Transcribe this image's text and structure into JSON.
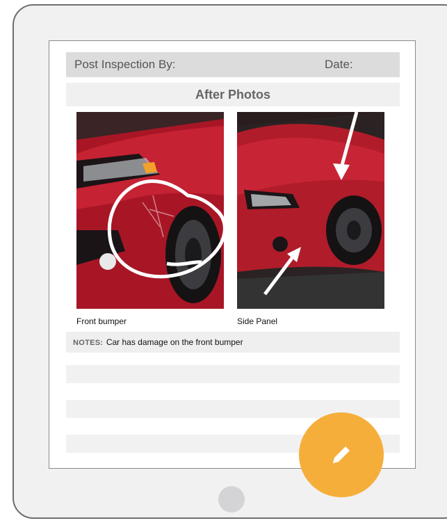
{
  "form": {
    "post_inspection_label": "Post Inspection By:",
    "date_label": "Date:",
    "section_title": "After Photos",
    "photos": [
      {
        "caption": "Front bumper",
        "icon": "car-photo-front-bumper"
      },
      {
        "caption": "Side Panel",
        "icon": "car-photo-side-panel"
      }
    ],
    "notes_label": "NOTES:",
    "notes_text": "Car has damage on the front bumper"
  },
  "edit_button": {
    "icon": "pencil-icon"
  },
  "colors": {
    "accent": "#f6ae3b",
    "car_red": "#b11c2a",
    "bezel": "#f1f1f2"
  }
}
